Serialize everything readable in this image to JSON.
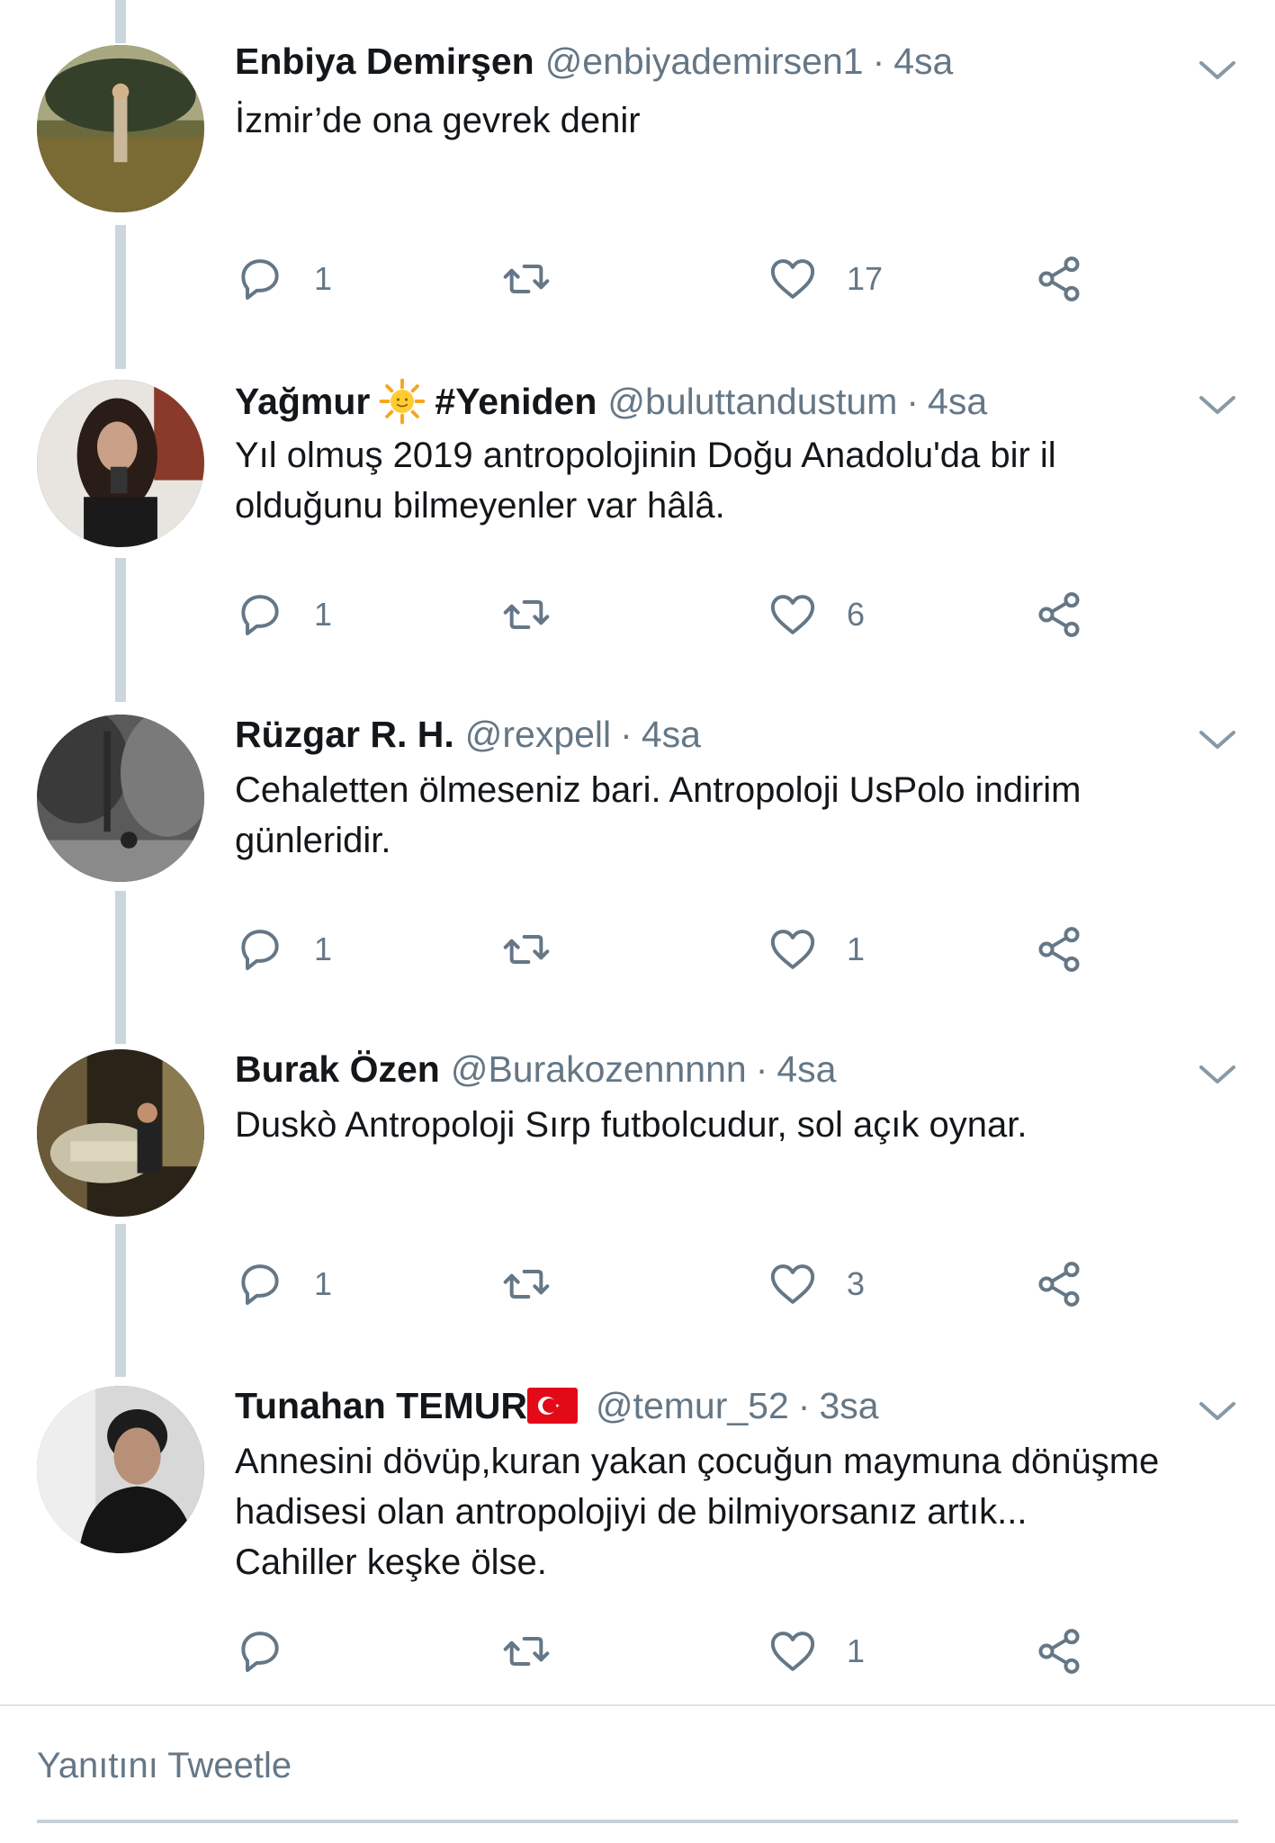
{
  "tweets": [
    {
      "name": "Enbiya Demirşen",
      "handle": "@enbiyademirsen1",
      "time": "4sa",
      "lines": [
        "İzmir’de ona gevrek denir"
      ],
      "replies": "1",
      "likes": "17"
    },
    {
      "name": "Yağmur",
      "name_suffix": "#Yeniden",
      "handle": "@buluttandustum",
      "time": "4sa",
      "lines": [
        "Yıl olmuş 2019 antropolojinin Doğu Anadolu'da bir il",
        "olduğunu bilmeyenler var hâlâ."
      ],
      "replies": "1",
      "likes": "6"
    },
    {
      "name": "Rüzgar R. H.",
      "handle": "@rexpell",
      "time": "4sa",
      "lines": [
        "Cehaletten ölmeseniz bari. Antropoloji UsPolo indirim",
        "günleridir."
      ],
      "replies": "1",
      "likes": "1"
    },
    {
      "name": "Burak Özen",
      "handle": "@Burakozennnnn",
      "time": "4sa",
      "lines": [
        "Duskò Antropoloji Sırp futbolcudur, sol açık oynar."
      ],
      "replies": "1",
      "likes": "3"
    },
    {
      "name": "Tunahan TEMUR",
      "handle": "@temur_52",
      "time": "3sa",
      "lines": [
        "Annesini dövüp,kuran yakan çocuğun maymuna dönüşme",
        "hadisesi olan antropolojiyi de bilmiyorsanız artık...",
        "Cahiller keşke ölse."
      ],
      "replies": "",
      "likes": "1"
    }
  ],
  "separator": "·",
  "reply_placeholder": "Yanıtını Tweetle",
  "colors": {
    "secondary_text": "#657786",
    "thread_line": "#ccd6dd",
    "primary_text": "#14171a"
  },
  "icons": [
    "reply-icon",
    "retweet-icon",
    "like-icon",
    "share-icon",
    "chevron-down-icon"
  ]
}
